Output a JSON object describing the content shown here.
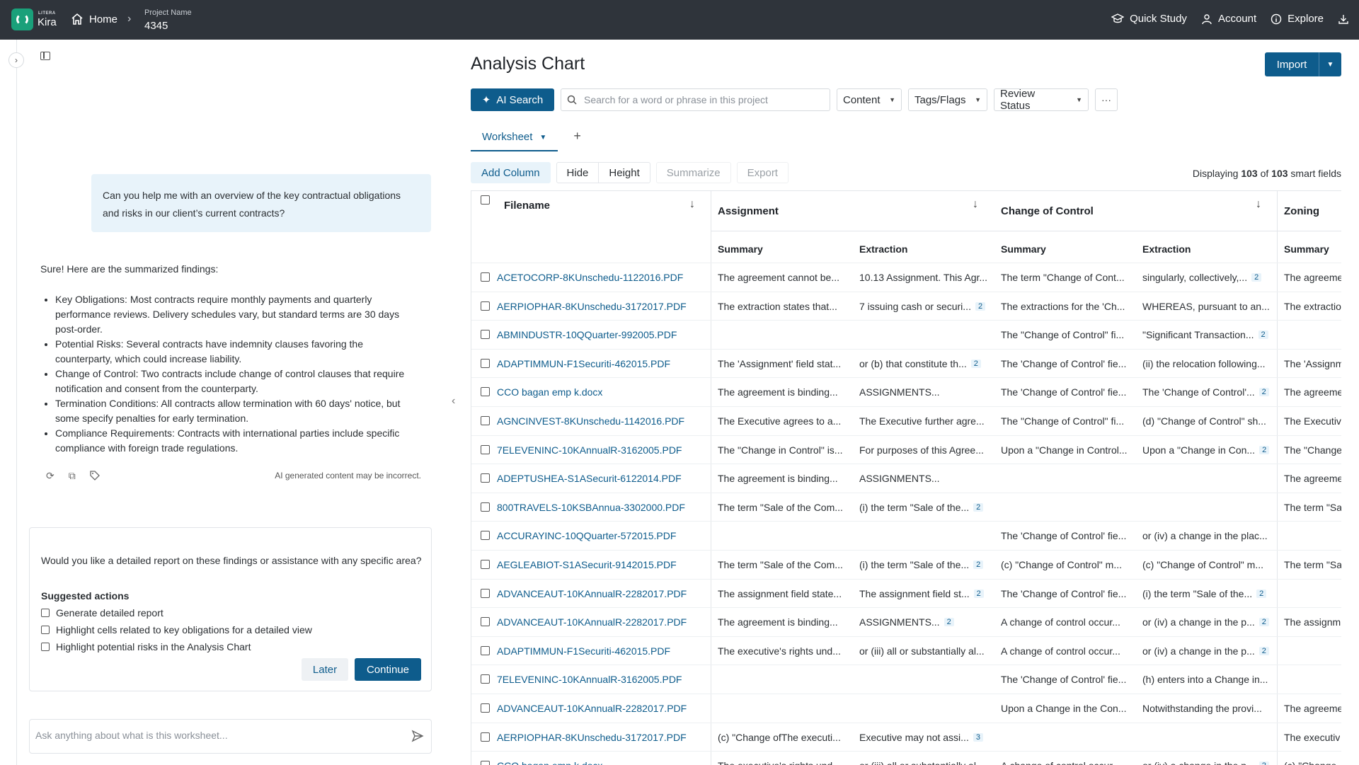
{
  "topbar": {
    "brand_small": "LITERA",
    "brand": "Kira",
    "home": "Home",
    "project_label": "Project Name",
    "project_value": "4345",
    "quick_study": "Quick Study",
    "account": "Account",
    "explore": "Explore"
  },
  "chat": {
    "user_message": "Can you help me with an overview of the key contractual obligations and risks in our client’s current contracts?",
    "reply_intro": "Sure! Here are the summarized findings:",
    "findings": [
      "Key Obligations: Most contracts require monthly payments and quarterly performance reviews. Delivery schedules vary, but standard terms are 30 days post-order.",
      "Potential Risks: Several contracts have indemnity clauses favoring the counterparty, which could increase liability.",
      "Change of Control: Two contracts include change of control clauses that require notification and consent from the counterparty.",
      "Termination Conditions: All contracts allow termination with 60 days' notice, but some specify penalties for early termination.",
      " Compliance Requirements: Contracts with international parties include specific compliance with foreign trade regulations."
    ],
    "disclaimer": "AI generated content may be incorrect.",
    "question": "Would you like a detailed report on these findings or assistance with any specific area?",
    "suggested_title": "Suggested actions",
    "suggestions": [
      "Generate detailed report",
      "Highlight cells related to key obligations for a detailed view",
      "Highlight potential risks in the Analysis Chart"
    ],
    "later": "Later",
    "continue": "Continue",
    "input_placeholder": "Ask anything about what is this worksheet..."
  },
  "main": {
    "title": "Analysis Chart",
    "import": "Import",
    "ai_search": "AI Search",
    "search_placeholder": "Search for a word or phrase in this project",
    "filters": [
      "Content",
      "Tags/Flags",
      "Review Status"
    ],
    "more": "···",
    "tab": "Worksheet",
    "buttons": {
      "add_column": "Add Column",
      "hide": "Hide",
      "height": "Height",
      "summarize": "Summarize",
      "export": "Export"
    },
    "display": {
      "prefix": "Displaying ",
      "shown": "103",
      "of": " of ",
      "total": "103",
      "suffix": " smart fields"
    }
  },
  "table": {
    "col_filename": "Filename",
    "groups": [
      "Assignment",
      "Change of Control",
      "Zoning"
    ],
    "subheaders": [
      "Summary",
      "Extraction",
      "Summary",
      "Extraction",
      "Summary"
    ],
    "rows": [
      {
        "file": "ACETOCORP-8KUnschedu-1122016.PDF",
        "a_sum": "The agreement cannot be...",
        "a_ext": "10.13 Assignment. This Agr...",
        "a_b": "",
        "c_sum": "The term \"Change of Cont...",
        "c_ext": "singularly, collectively,...",
        "c_b": "2",
        "z_sum": "The agreeme"
      },
      {
        "file": "AERPIOPHAR-8KUnschedu-3172017.PDF",
        "a_sum": "The extraction states that...",
        "a_ext": "7 issuing cash or securi...",
        "a_b": "2",
        "c_sum": "The extractions for the 'Ch...",
        "c_ext": "WHEREAS, pursuant to an...",
        "c_b": "",
        "z_sum": "The extractio"
      },
      {
        "file": "ABMINDUSTR-10QQuarter-992005.PDF",
        "a_sum": "",
        "a_ext": "",
        "a_b": "",
        "c_sum": "The \"Change of Control\" fi...",
        "c_ext": "\"Significant Transaction...",
        "c_b": "2",
        "z_sum": ""
      },
      {
        "file": "ADAPTIMMUN-F1Securiti-462015.PDF",
        "a_sum": "The 'Assignment' field stat...",
        "a_ext": "or (b) that constitute th...",
        "a_b": "2",
        "c_sum": "The 'Change of Control' fie...",
        "c_ext": "(ii) the relocation following...",
        "c_b": "",
        "z_sum": "The 'Assignm"
      },
      {
        "file": "CCO bagan emp k.docx",
        "a_sum": "The agreement is binding...",
        "a_ext": "ASSIGNMENTS...",
        "a_b": "",
        "c_sum": "The 'Change of Control' fie...",
        "c_ext": "The 'Change of Control'...",
        "c_b": "2",
        "z_sum": "The agreeme"
      },
      {
        "file": "AGNCINVEST-8KUnschedu-1142016.PDF",
        "a_sum": "The Executive agrees to a...",
        "a_ext": "The Executive further agre...",
        "a_b": "",
        "c_sum": "The \"Change of Control\" fi...",
        "c_ext": "(d) \"Change of Control\" sh...",
        "c_b": "",
        "z_sum": "The Executiv"
      },
      {
        "file": "7ELEVENINC-10KAnnualR-3162005.PDF",
        "a_sum": "The \"Change in Control\" is...",
        "a_ext": "For purposes of this Agree...",
        "a_b": "",
        "c_sum": "Upon a \"Change in Control...",
        "c_ext": "Upon a \"Change in Con...",
        "c_b": "2",
        "z_sum": "The \"Change"
      },
      {
        "file": "ADEPTUSHEA-S1ASecurit-6122014.PDF",
        "a_sum": "The agreement is binding...",
        "a_ext": "ASSIGNMENTS...",
        "a_b": "",
        "c_sum": "",
        "c_ext": "",
        "c_b": "",
        "z_sum": "The agreeme"
      },
      {
        "file": "800TRAVELS-10KSBAnnua-3302000.PDF",
        "a_sum": "The term \"Sale of the Com...",
        "a_ext": "(i) the term \"Sale of the...",
        "a_b": "2",
        "c_sum": "",
        "c_ext": "",
        "c_b": "",
        "z_sum": "The term \"Sa"
      },
      {
        "file": "ACCURAYINC-10QQuarter-572015.PDF",
        "a_sum": "",
        "a_ext": "",
        "a_b": "",
        "c_sum": "The 'Change of Control' fie...",
        "c_ext": "or (iv) a change in the plac...",
        "c_b": "",
        "z_sum": ""
      },
      {
        "file": "AEGLEABIOT-S1ASecurit-9142015.PDF",
        "a_sum": "The term \"Sale of the Com...",
        "a_ext": "(i) the term \"Sale of the...",
        "a_b": "2",
        "c_sum": "(c) \"Change of Control\" m...",
        "c_ext": "(c) \"Change of Control\" m...",
        "c_b": "",
        "z_sum": "The term \"Sa"
      },
      {
        "file": "ADVANCEAUT-10KAnnualR-2282017.PDF",
        "a_sum": "The assignment field state...",
        "a_ext": "The assignment field st...",
        "a_b": "2",
        "c_sum": "The 'Change of Control' fie...",
        "c_ext": "(i) the term \"Sale of the...",
        "c_b": "2",
        "z_sum": ""
      },
      {
        "file": "ADVANCEAUT-10KAnnualR-2282017.PDF",
        "a_sum": "The agreement is binding...",
        "a_ext": "ASSIGNMENTS...",
        "a_b": "2",
        "c_sum": "A change of control occur...",
        "c_ext": "or (iv) a change in the p...",
        "c_b": "2",
        "z_sum": "The assignm"
      },
      {
        "file": "ADAPTIMMUN-F1Securiti-462015.PDF",
        "a_sum": "The executive's rights und...",
        "a_ext": "or (iii) all or substantially al...",
        "a_b": "",
        "c_sum": "A change of control occur...",
        "c_ext": "or (iv) a change in the p...",
        "c_b": "2",
        "z_sum": ""
      },
      {
        "file": "7ELEVENINC-10KAnnualR-3162005.PDF",
        "a_sum": "",
        "a_ext": "",
        "a_b": "",
        "c_sum": "The 'Change of Control' fie...",
        "c_ext": "(h) enters into a Change in...",
        "c_b": "",
        "z_sum": ""
      },
      {
        "file": "ADVANCEAUT-10KAnnualR-2282017.PDF",
        "a_sum": "",
        "a_ext": "",
        "a_b": "",
        "c_sum": "Upon a Change in the Con...",
        "c_ext": "Notwithstanding the provi...",
        "c_b": "",
        "z_sum": "The agreeme"
      },
      {
        "file": "AERPIOPHAR-8KUnschedu-3172017.PDF",
        "a_sum": "(c) \"Change ofThe executi...",
        "a_ext": "Executive may not assi...",
        "a_b": "3",
        "c_sum": "",
        "c_ext": "",
        "c_b": "",
        "z_sum": "The executiv"
      },
      {
        "file": "CCO bagan emp k.docx",
        "a_sum": "The executive's rights und...",
        "a_ext": "or (iii) all or substantially al...",
        "a_b": "",
        "c_sum": "A change of control occur...",
        "c_ext": "or (iv) a change in the p...",
        "c_b": "2",
        "z_sum": "(c) \"Change"
      }
    ]
  }
}
